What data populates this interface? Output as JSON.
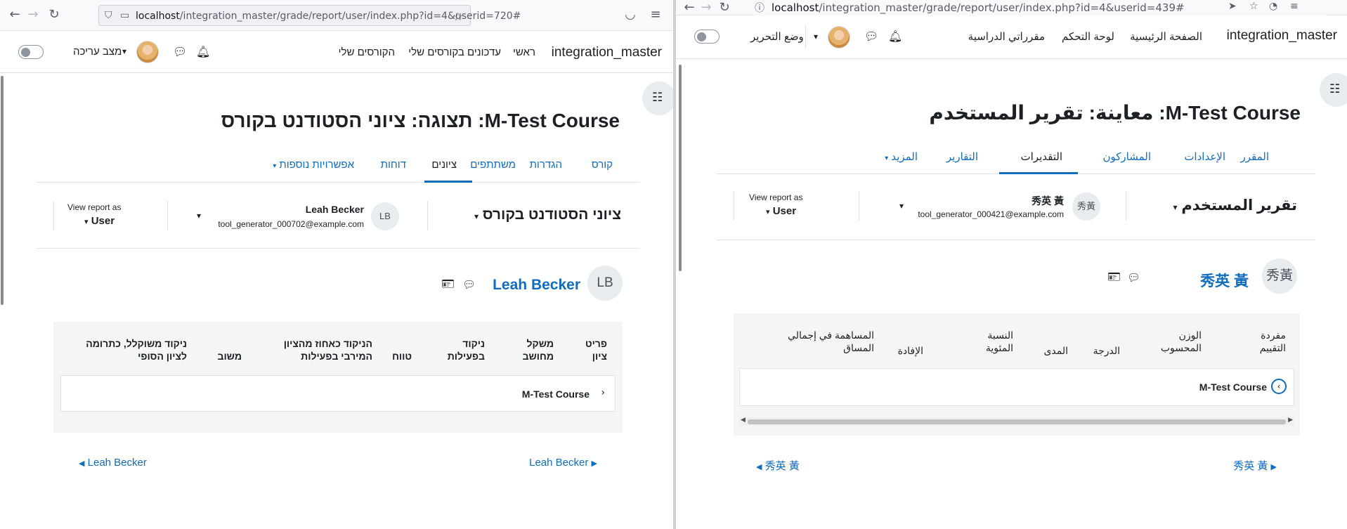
{
  "left_window": {
    "browser": {
      "url_host": "localhost",
      "url_path": "/integration_master/grade/report/user/index.php?id=4&userid=720#"
    },
    "navbar": {
      "brand": "integration_master",
      "links": [
        "ראשי",
        "עדכונים בקורסים שלי",
        "הקורסים שלי"
      ],
      "edit_mode_label": "מצב עריכה"
    },
    "page_title": "M-Test Course: תצוגה: ציוני הסטודנט בקורס",
    "tabs": [
      "קורס",
      "הגדרות",
      "משתתפים",
      "ציונים",
      "דוחות",
      "אפשרויות נוספות"
    ],
    "active_tab": "ציונים",
    "tertiary": {
      "report_selector": "ציוני הסטודנט בקורס",
      "user_initials": "LB",
      "user_name": "Leah Becker",
      "user_email": "tool_generator_000702@example.com",
      "view_as_label": "View report as",
      "view_as_value": "User"
    },
    "user_header": {
      "initials": "LB",
      "name": "Leah Becker"
    },
    "table": {
      "columns": [
        "פריט ציון",
        "משקל מחושב",
        "ניקוד בפעילות",
        "טווח",
        "הניקוד כאחוז מהציון המירבי בפעילות",
        "משוב",
        "ניקוד משוקלל, כתרומה לציון הסופי"
      ],
      "rows": [
        "M-Test Course"
      ]
    },
    "pager": {
      "prev": "Leah Becker",
      "next": "Leah Becker"
    }
  },
  "right_window": {
    "browser": {
      "url_host": "localhost",
      "url_path": "/integration_master/grade/report/user/index.php?id=4&userid=439#"
    },
    "navbar": {
      "brand": "integration_master",
      "links": [
        "الصفحة الرئيسية",
        "لوحة التحكم",
        "مقرراتي الدراسية"
      ],
      "edit_mode_label": "وضع التحرير"
    },
    "page_title": "M-Test Course: معاينة: تقرير المستخدم",
    "tabs": [
      "المقرر",
      "الإعدادات",
      "المشاركون",
      "التقديرات",
      "التقارير",
      "المزيد"
    ],
    "active_tab": "التقديرات",
    "tertiary": {
      "report_selector": "تقرير المستخدم",
      "user_initials": "秀黃",
      "user_name": "秀英 黃",
      "user_email": "tool_generator_000421@example.com",
      "view_as_label": "View report as",
      "view_as_value": "User"
    },
    "user_header": {
      "initials": "秀黃",
      "name": "秀英 黃"
    },
    "table": {
      "columns": [
        "مفردة التقييم",
        "الوزن المحسوب",
        "الدرجة",
        "المدى",
        "النسبة المئوية",
        "الإفادة",
        "المساهمة في إجمالي المساق"
      ],
      "rows": [
        "M-Test Course"
      ]
    },
    "pager": {
      "prev": "秀英 黃",
      "next": "秀英 黃"
    }
  },
  "colors": {
    "link_blue": "#0f6cbf",
    "text": "#1d2125",
    "panel_bg": "#f5f5f5"
  },
  "icons": [
    "back-arrow-icon",
    "forward-arrow-icon",
    "reload-icon",
    "shield-icon",
    "page-icon",
    "star-icon",
    "pocket-icon",
    "menu-icon",
    "send-icon",
    "profile-icon",
    "bell-icon",
    "chat-icon",
    "index-drawer-icon",
    "contact-card-icon"
  ]
}
